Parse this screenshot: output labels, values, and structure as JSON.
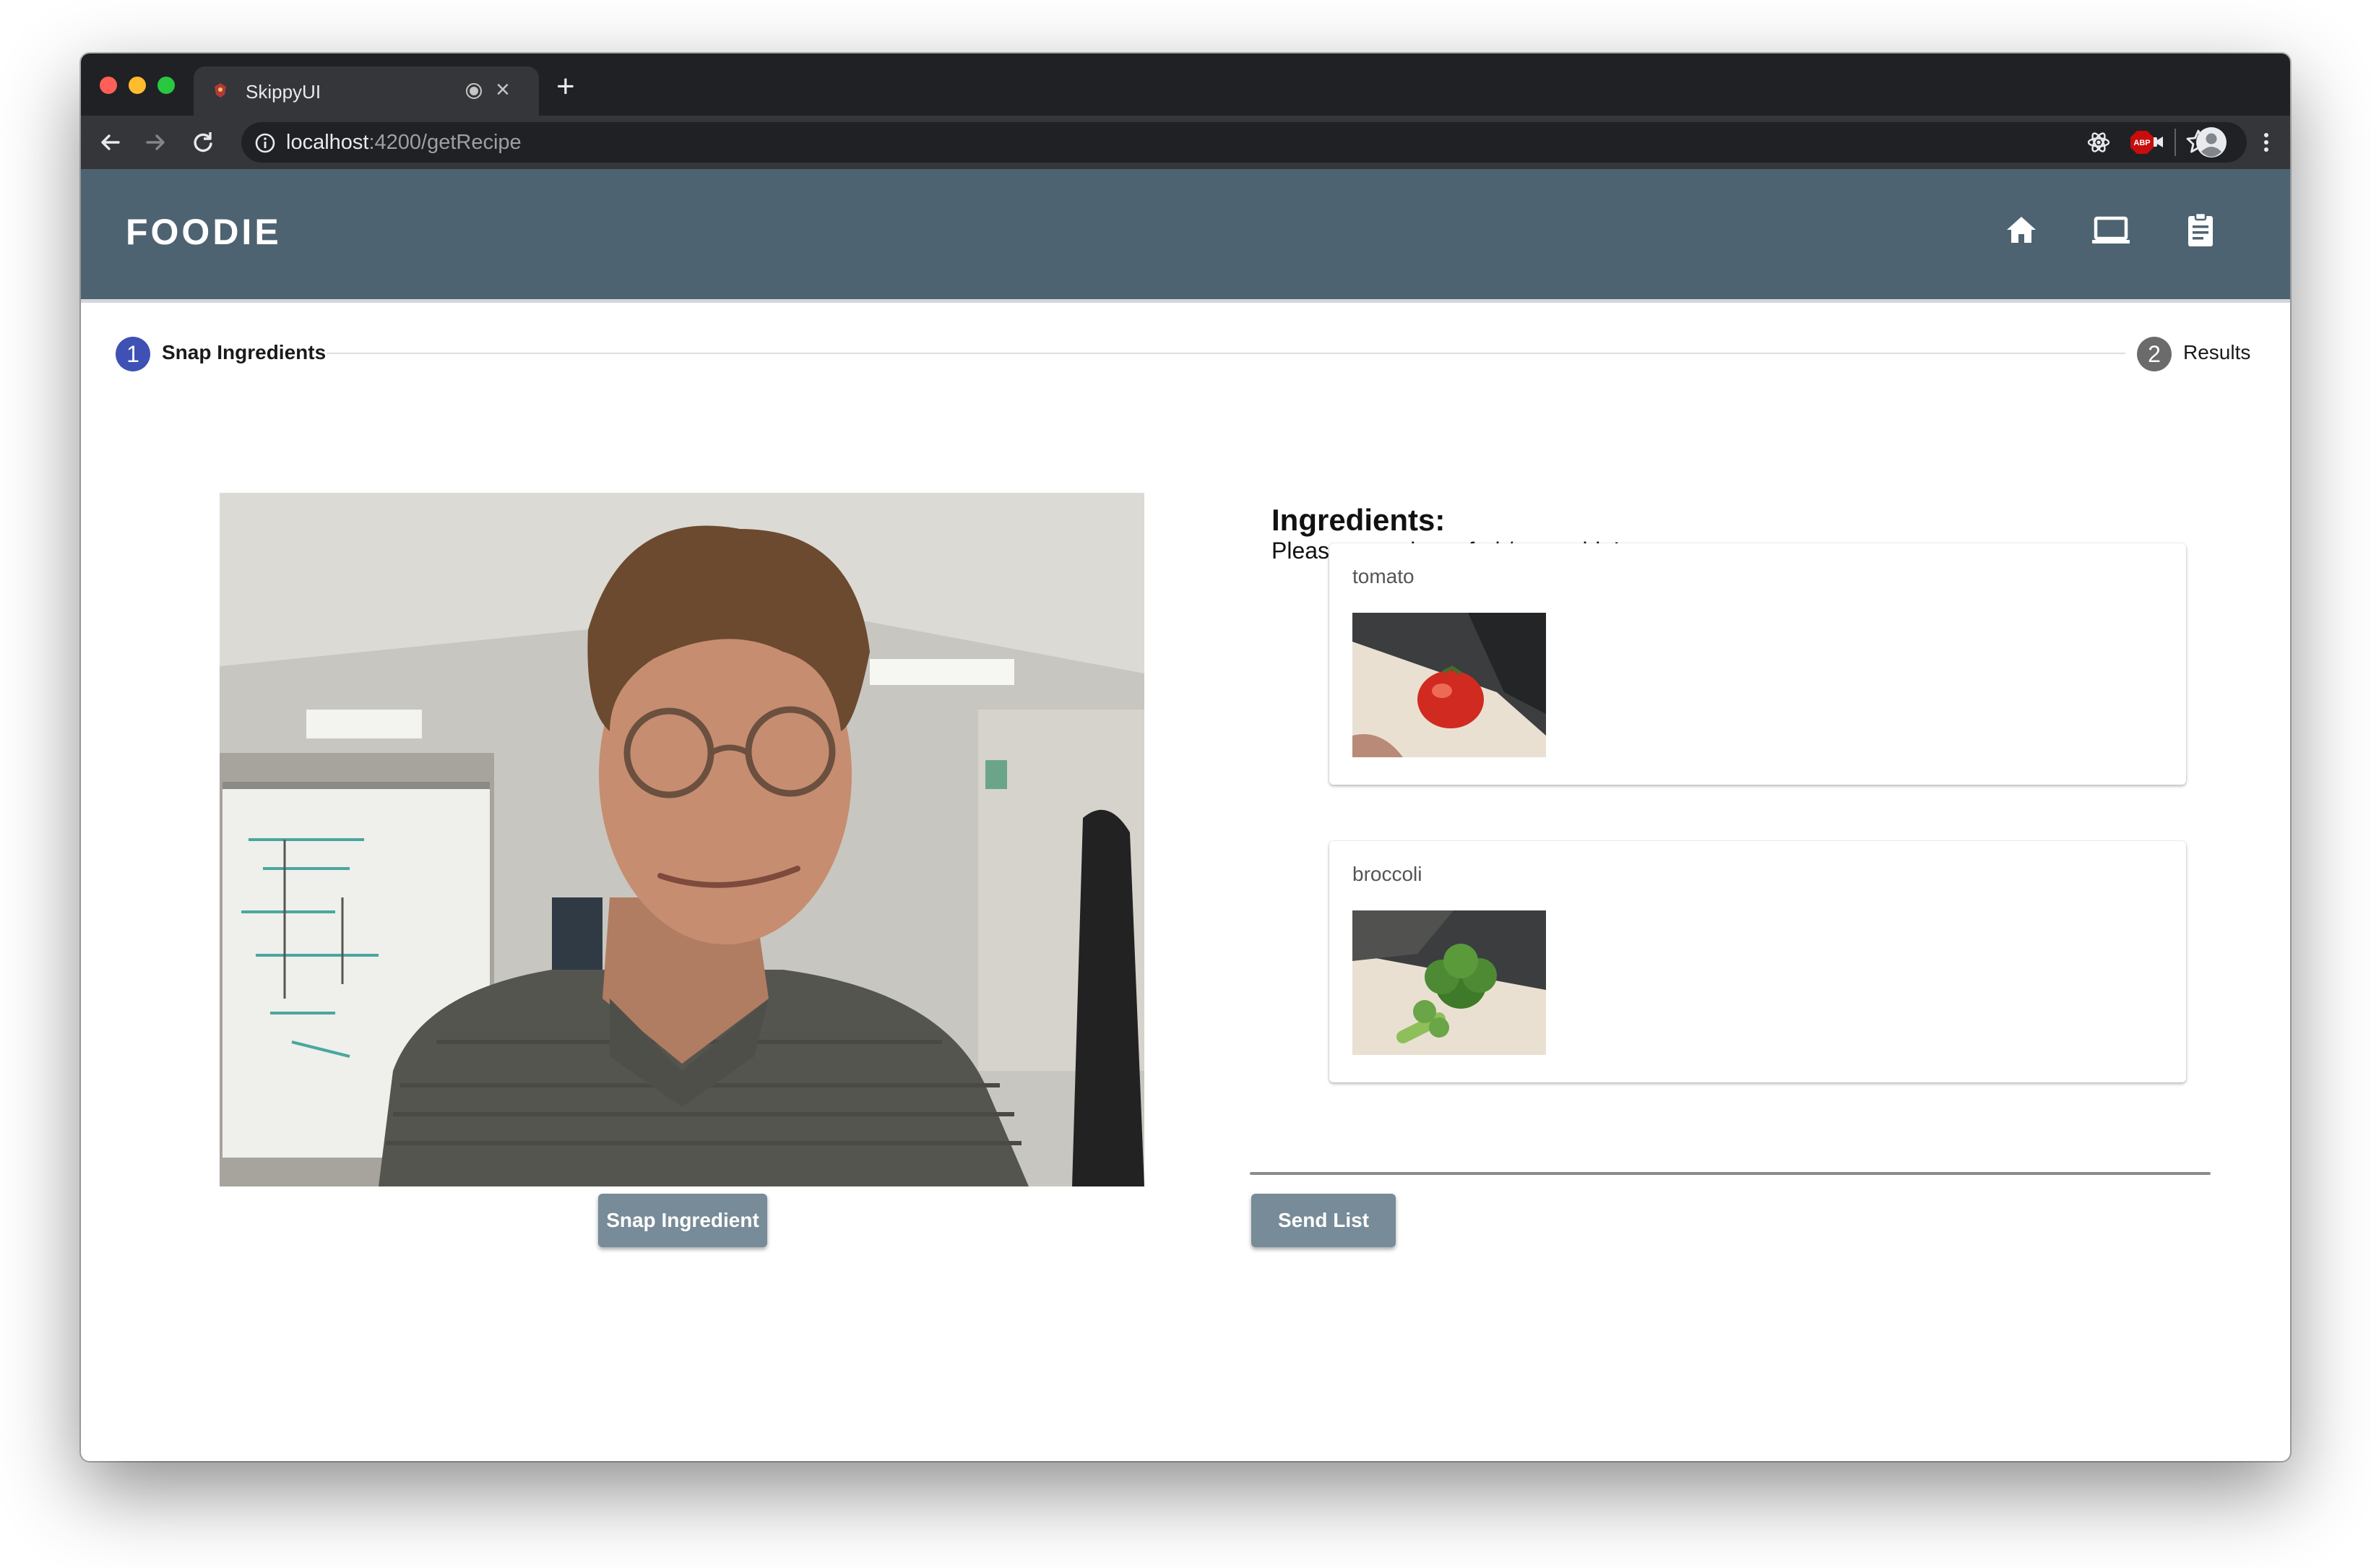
{
  "browser": {
    "tab_title": "SkippyUI",
    "new_tab_symbol": "+",
    "close_symbol": "×",
    "url_host": "localhost",
    "url_path": ":4200/getRecipe",
    "icons": [
      "back-icon",
      "forward-icon",
      "reload-icon",
      "info-icon",
      "camera-indicator-icon",
      "star-icon",
      "extension-icon",
      "abp-icon",
      "profile-icon",
      "menu-icon"
    ],
    "abp_label": "ABP"
  },
  "app": {
    "brand": "FOODIE",
    "nav_icons": [
      "home-icon",
      "laptop-icon",
      "clipboard-icon"
    ],
    "header_color": "#4e6371"
  },
  "stepper": {
    "steps": [
      {
        "number": "1",
        "label": "Snap Ingredients",
        "active": true
      },
      {
        "number": "2",
        "label": "Results",
        "active": false
      }
    ],
    "active_color": "#3f51b5",
    "inactive_color": "#6b6b6b"
  },
  "camera": {
    "snap_button": "Snap Ingredient"
  },
  "ingredients": {
    "title": "Ingredients:",
    "subtitle": "Please snapshot a fruit/vegetable!",
    "items": [
      {
        "name": "tomato"
      },
      {
        "name": "broccoli"
      }
    ],
    "send_button": "Send List"
  },
  "button_color": "#778b98"
}
